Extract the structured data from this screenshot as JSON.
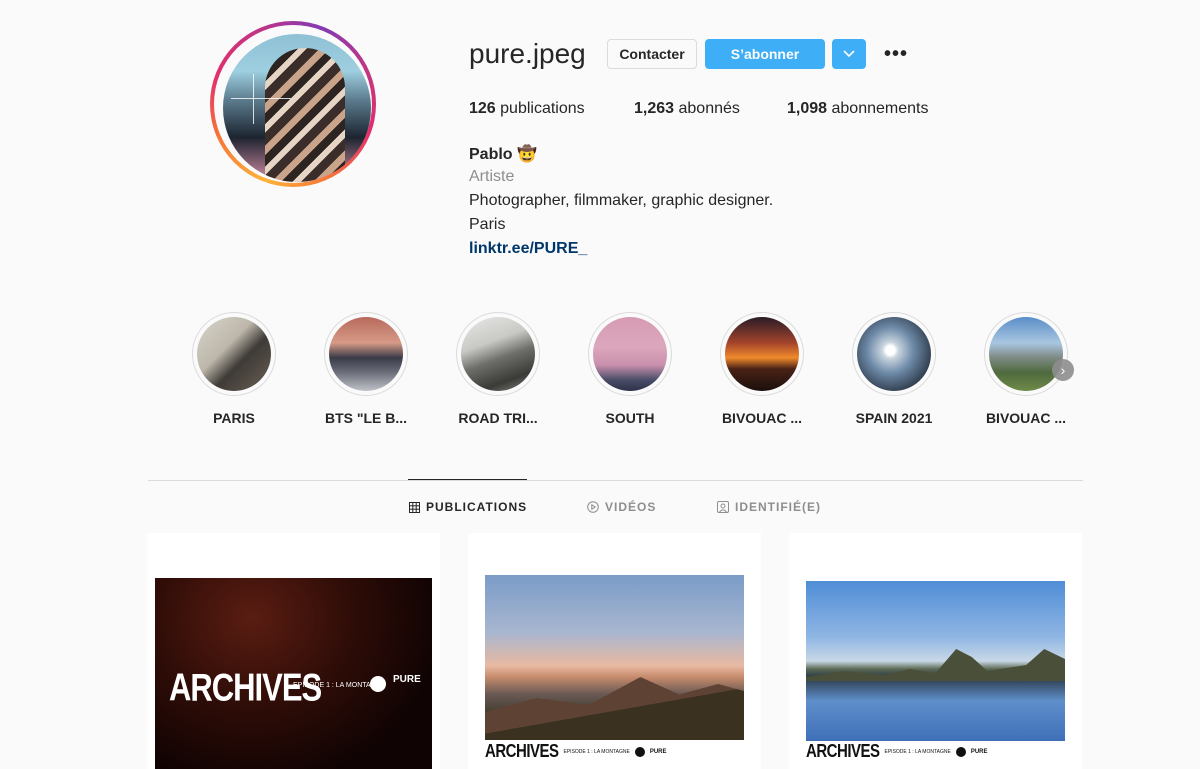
{
  "profile": {
    "username": "pure.jpeg",
    "buttons": {
      "contact": "Contacter",
      "follow": "S’abonner",
      "more": "•••"
    },
    "stats": {
      "posts_count": "126",
      "posts_label": "publications",
      "followers_count": "1,263",
      "followers_label": "abonnés",
      "following_count": "1,098",
      "following_label": "abonnements"
    },
    "bio": {
      "name": "Pablo 🤠",
      "category": "Artiste",
      "line1": "Photographer, filmmaker, graphic designer.",
      "line2": "Paris",
      "link": "linktr.ee/PURE_"
    }
  },
  "highlights": [
    {
      "label": "PARIS"
    },
    {
      "label": "BTS \"LE B..."
    },
    {
      "label": "ROAD TRI..."
    },
    {
      "label": "SOUTH"
    },
    {
      "label": "BIVOUAC ..."
    },
    {
      "label": "SPAIN 2021"
    },
    {
      "label": "BIVOUAC ..."
    }
  ],
  "tabs": [
    {
      "label": "PUBLICATIONS",
      "active": true
    },
    {
      "label": "VIDÉOS",
      "active": false
    },
    {
      "label": "IDENTIFIÉ(E)",
      "active": false
    }
  ],
  "posts": [
    {
      "title": "ARCHIVES",
      "subtitle": "EPISODE 1 : LA MONTAGNE",
      "logo": "PURE"
    },
    {
      "title": "ARCHIVES",
      "subtitle": "EPISODE 1 : LA MONTAGNE",
      "logo": "PURE"
    },
    {
      "title": "ARCHIVES",
      "subtitle": "EPISODE 1 : LA MONTAGNE",
      "logo": "PURE"
    }
  ],
  "colors": {
    "accent": "#0095f6",
    "link": "#00376b",
    "muted": "#8e8e8e"
  }
}
